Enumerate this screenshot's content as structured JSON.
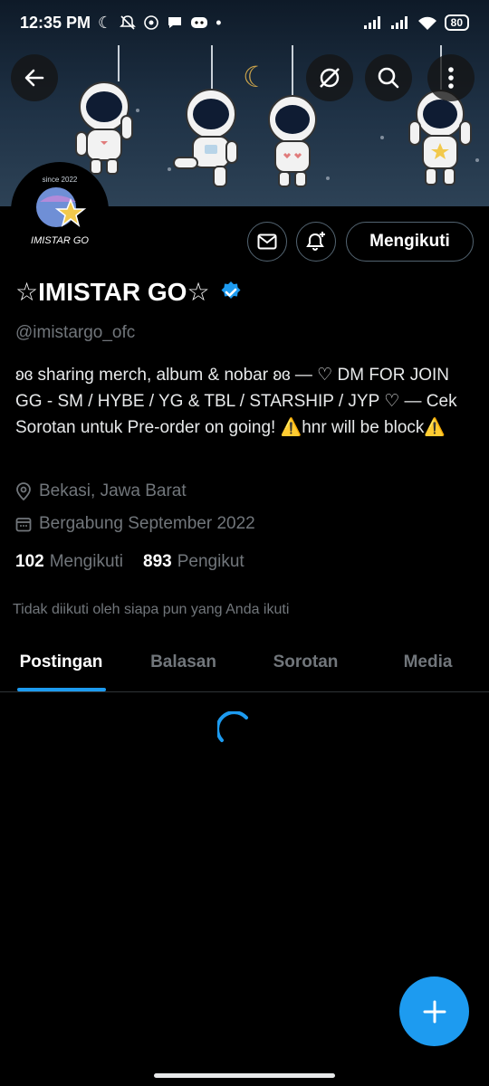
{
  "status_bar": {
    "time": "12:35 PM",
    "battery": "80",
    "icons": [
      "moon-icon",
      "mute-icon",
      "whatsapp-icon",
      "chat-icon",
      "discord-icon",
      "dot-icon",
      "signal-icon",
      "signal-icon",
      "wifi-icon"
    ]
  },
  "header": {
    "back_icon": "arrow-left-icon",
    "grok_icon": "grok-icon",
    "search_icon": "search-icon",
    "more_icon": "more-vertical-icon"
  },
  "avatar": {
    "since_text": "since 2022",
    "logo_text": "IMISTAR GO"
  },
  "actions": {
    "message_icon": "envelope-icon",
    "notify_icon": "bell-plus-icon",
    "follow_label": "Mengikuti"
  },
  "profile": {
    "name": "☆IMISTAR GO☆",
    "verified": true,
    "handle": "@imistargo_ofc",
    "bio": "ʚɞ sharing merch, album & nobar ʚɞ — ♡ DM FOR JOIN GG - SM / HYBE / YG & TBL / STARSHIP / JYP ♡ — Cek Sorotan untuk Pre-order on going!  ⚠️hnr will be block⚠️",
    "location": "Bekasi, Jawa Barat",
    "joined": "Bergabung September 2022"
  },
  "stats": {
    "following_count": "102",
    "following_label": "Mengikuti",
    "followers_count": "893",
    "followers_label": "Pengikut"
  },
  "not_followed_text": "Tidak diikuti oleh siapa pun yang Anda ikuti",
  "tabs": [
    {
      "label": "Postingan",
      "active": true
    },
    {
      "label": "Balasan",
      "active": false
    },
    {
      "label": "Sorotan",
      "active": false
    },
    {
      "label": "Media",
      "active": false
    }
  ],
  "colors": {
    "accent": "#1d9bf0",
    "background": "#000000",
    "muted": "#71767b"
  }
}
